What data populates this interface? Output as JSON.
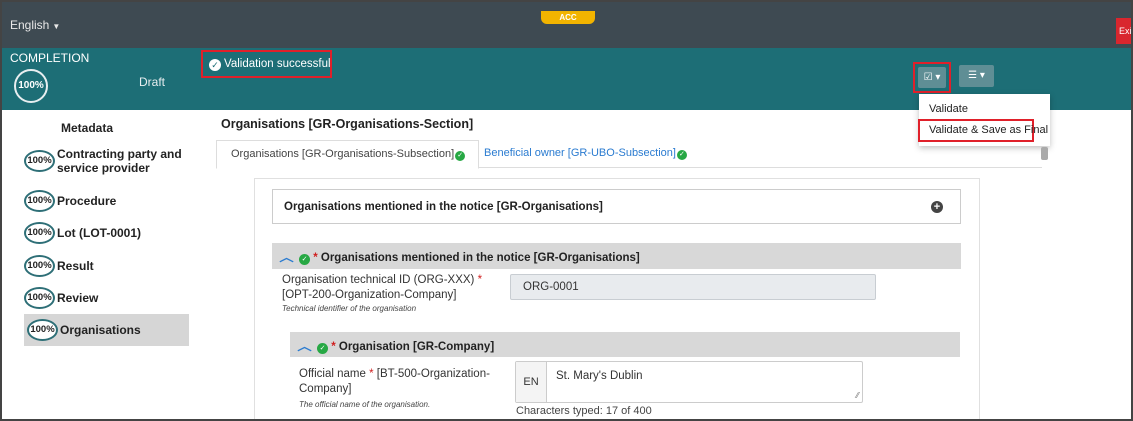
{
  "topbar": {
    "language": "English",
    "env_badge": "ACC",
    "exit_label": "Exit"
  },
  "status": {
    "completion_label": "COMPLETION",
    "completion_pct": "100%",
    "state": "Draft",
    "validation_msg": "Validation successful"
  },
  "toolbar": {
    "validate_btn_icon": "check-square-icon",
    "settings_btn_icon": "sliders-icon"
  },
  "dropdown": {
    "items": [
      "Validate",
      "Validate & Save as Final"
    ]
  },
  "sidebar": {
    "heading": "Metadata",
    "items": [
      {
        "pct": "100%",
        "label": "Contracting party and service provider"
      },
      {
        "pct": "100%",
        "label": "Procedure"
      },
      {
        "pct": "100%",
        "label": "Lot (LOT-0001)"
      },
      {
        "pct": "100%",
        "label": "Result"
      },
      {
        "pct": "100%",
        "label": "Review"
      },
      {
        "pct": "100%",
        "label": "Organisations"
      }
    ]
  },
  "main": {
    "section_title": "Organisations [GR-Organisations-Section]",
    "tabs": [
      {
        "label": "Organisations  [GR-Organisations-Subsection]"
      },
      {
        "label": "Beneficial owner  [GR-UBO-Subsection]"
      }
    ],
    "collapsed_group": {
      "title": "Organisations mentioned in the notice  [GR-Organisations]"
    },
    "expanded_group": {
      "title": "Organisations mentioned in the notice  [GR-Organisations]"
    },
    "org_id_field": {
      "label": "Organisation technical ID (ORG-XXX)",
      "code": " [OPT-200-Organization-Company]",
      "hint": "Technical identifier of the organisation",
      "value": "ORG-0001"
    },
    "company_group": {
      "title": "Organisation  [GR-Company]"
    },
    "official_name_field": {
      "label": "Official name",
      "code": " [BT-500-Organization-Company]",
      "hint": "The official name of the organisation.",
      "lang": "EN",
      "value": "St. Mary's Dublin",
      "char_count": "Characters typed: 17 of 400"
    }
  }
}
